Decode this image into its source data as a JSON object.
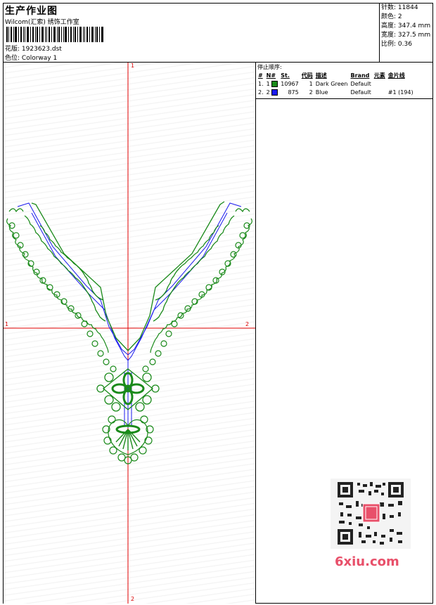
{
  "header": {
    "title": "生产作业图",
    "company": "Wilcom(汇索) 绣饰工作室",
    "pattern_label": "花版:",
    "pattern_value": "1923623.dst",
    "colorway_label": "色位:",
    "colorway_value": "Colorway 1"
  },
  "specs": [
    {
      "label": "针数:",
      "value": "11844"
    },
    {
      "label": "颜色:",
      "value": "2"
    },
    {
      "label": "高度:",
      "value": "347.4 mm"
    },
    {
      "label": "宽度:",
      "value": "327.5 mm"
    },
    {
      "label": "比例:",
      "value": "0.36"
    }
  ],
  "axes": {
    "top": "1",
    "bottom": "2",
    "left": "1",
    "right": "2"
  },
  "stops": {
    "title": "停止顺序:",
    "headers": [
      "#",
      "N#",
      "St.",
      "代码",
      "描述",
      "Brand",
      "元素",
      "金片线"
    ],
    "rows": [
      {
        "idx": "1.",
        "n": "1",
        "color": "#1a8a1a",
        "st": "10967",
        "code": "1",
        "desc": "Dark Green",
        "brand": "Default",
        "elem": "",
        "seq": ""
      },
      {
        "idx": "2.",
        "n": "2",
        "color": "#1a1aee",
        "st": "875",
        "code": "2",
        "desc": "Blue",
        "brand": "Default",
        "elem": "",
        "seq": "#1 (194)"
      }
    ]
  },
  "watermark": "6xiu.com",
  "colors": {
    "green": "#1a8a1a",
    "blue": "#1a1aee",
    "axis": "#e00000"
  }
}
